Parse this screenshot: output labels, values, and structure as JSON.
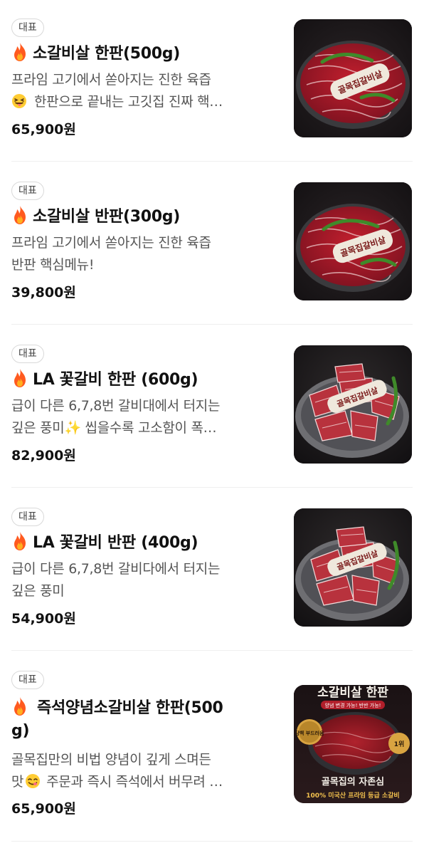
{
  "menu": {
    "items": [
      {
        "badge": "대표",
        "title": "소갈비살 한판(500g)",
        "title_lines": [
          "소갈비살 한판(500g)"
        ],
        "desc_lines": [
          "프라임 고기에서 쏟아지는 진한 육즙",
          "한판으로 끝내는 고깃집 진짜 핵…"
        ],
        "desc_emoji_line": 1,
        "desc_emoji": "tongue-face-icon",
        "price": "65,900원",
        "image_label": "골목집갈비살",
        "image_type": "ribs-plate"
      },
      {
        "badge": "대표",
        "title": "소갈비살 반판(300g)",
        "title_lines": [
          "소갈비살 반판(300g)"
        ],
        "desc_lines": [
          "프라임 고기에서 쏟아지는 진한 육즙",
          "반판 핵심메뉴!"
        ],
        "desc_emoji_line": -1,
        "desc_emoji": "",
        "price": "39,800원",
        "image_label": "골목집갈비살",
        "image_type": "ribs-plate"
      },
      {
        "badge": "대표",
        "title": "LA 꽃갈비 한판 (600g)",
        "title_lines": [
          "LA 꽃갈비 한판 (600g)"
        ],
        "desc_lines": [
          "급이 다른 6,7,8번 갈비대에서 터지는",
          "깊은 풍미✨ 씹을수록 고소함이 폭…"
        ],
        "desc_emoji_line": -1,
        "desc_emoji": "",
        "price": "82,900원",
        "image_label": "골목집갈비살",
        "image_type": "la-galbi"
      },
      {
        "badge": "대표",
        "title": "LA 꽃갈비 반판 (400g)",
        "title_lines": [
          "LA 꽃갈비 반판 (400g)"
        ],
        "desc_lines": [
          "급이 다른 6,7,8번 갈비다에서 터지는",
          "깊은 풍미"
        ],
        "desc_emoji_line": -1,
        "desc_emoji": "",
        "price": "54,900원",
        "image_label": "골목집갈비살",
        "image_type": "la-galbi"
      },
      {
        "badge": "대표",
        "title": "즉석양념소갈비살 한판(500g)",
        "title_lines": [
          "즉석양념소갈비살 한판(500",
          "g)"
        ],
        "desc_lines": [
          "골목집만의 비법 양념이 깊게 스며든",
          "맛 주문과 즉시 즉석에서 버무려 …"
        ],
        "desc_emoji_line": 1,
        "desc_emoji": "yum-face-icon",
        "desc_prefix_split": [
          "맛",
          "주문과 즉시 즉석에서 버무려 …"
        ],
        "price": "65,900원",
        "image_label": "",
        "image_type": "marinated-poster",
        "poster": {
          "headline": "소갈비살 한판",
          "sub": "양념 변경 가능! 반반 가능!",
          "badge_left": "담백 부드러움",
          "badge_right": "1위",
          "tagline": "골목집의 자존심",
          "bottom": "100% 미국산 프라임 등급 소갈비"
        }
      }
    ]
  },
  "colors": {
    "price": "#111111",
    "desc": "#555555",
    "badge_border": "#d9d9d9",
    "divider": "#efefef",
    "fire": "#ff5a1f"
  }
}
